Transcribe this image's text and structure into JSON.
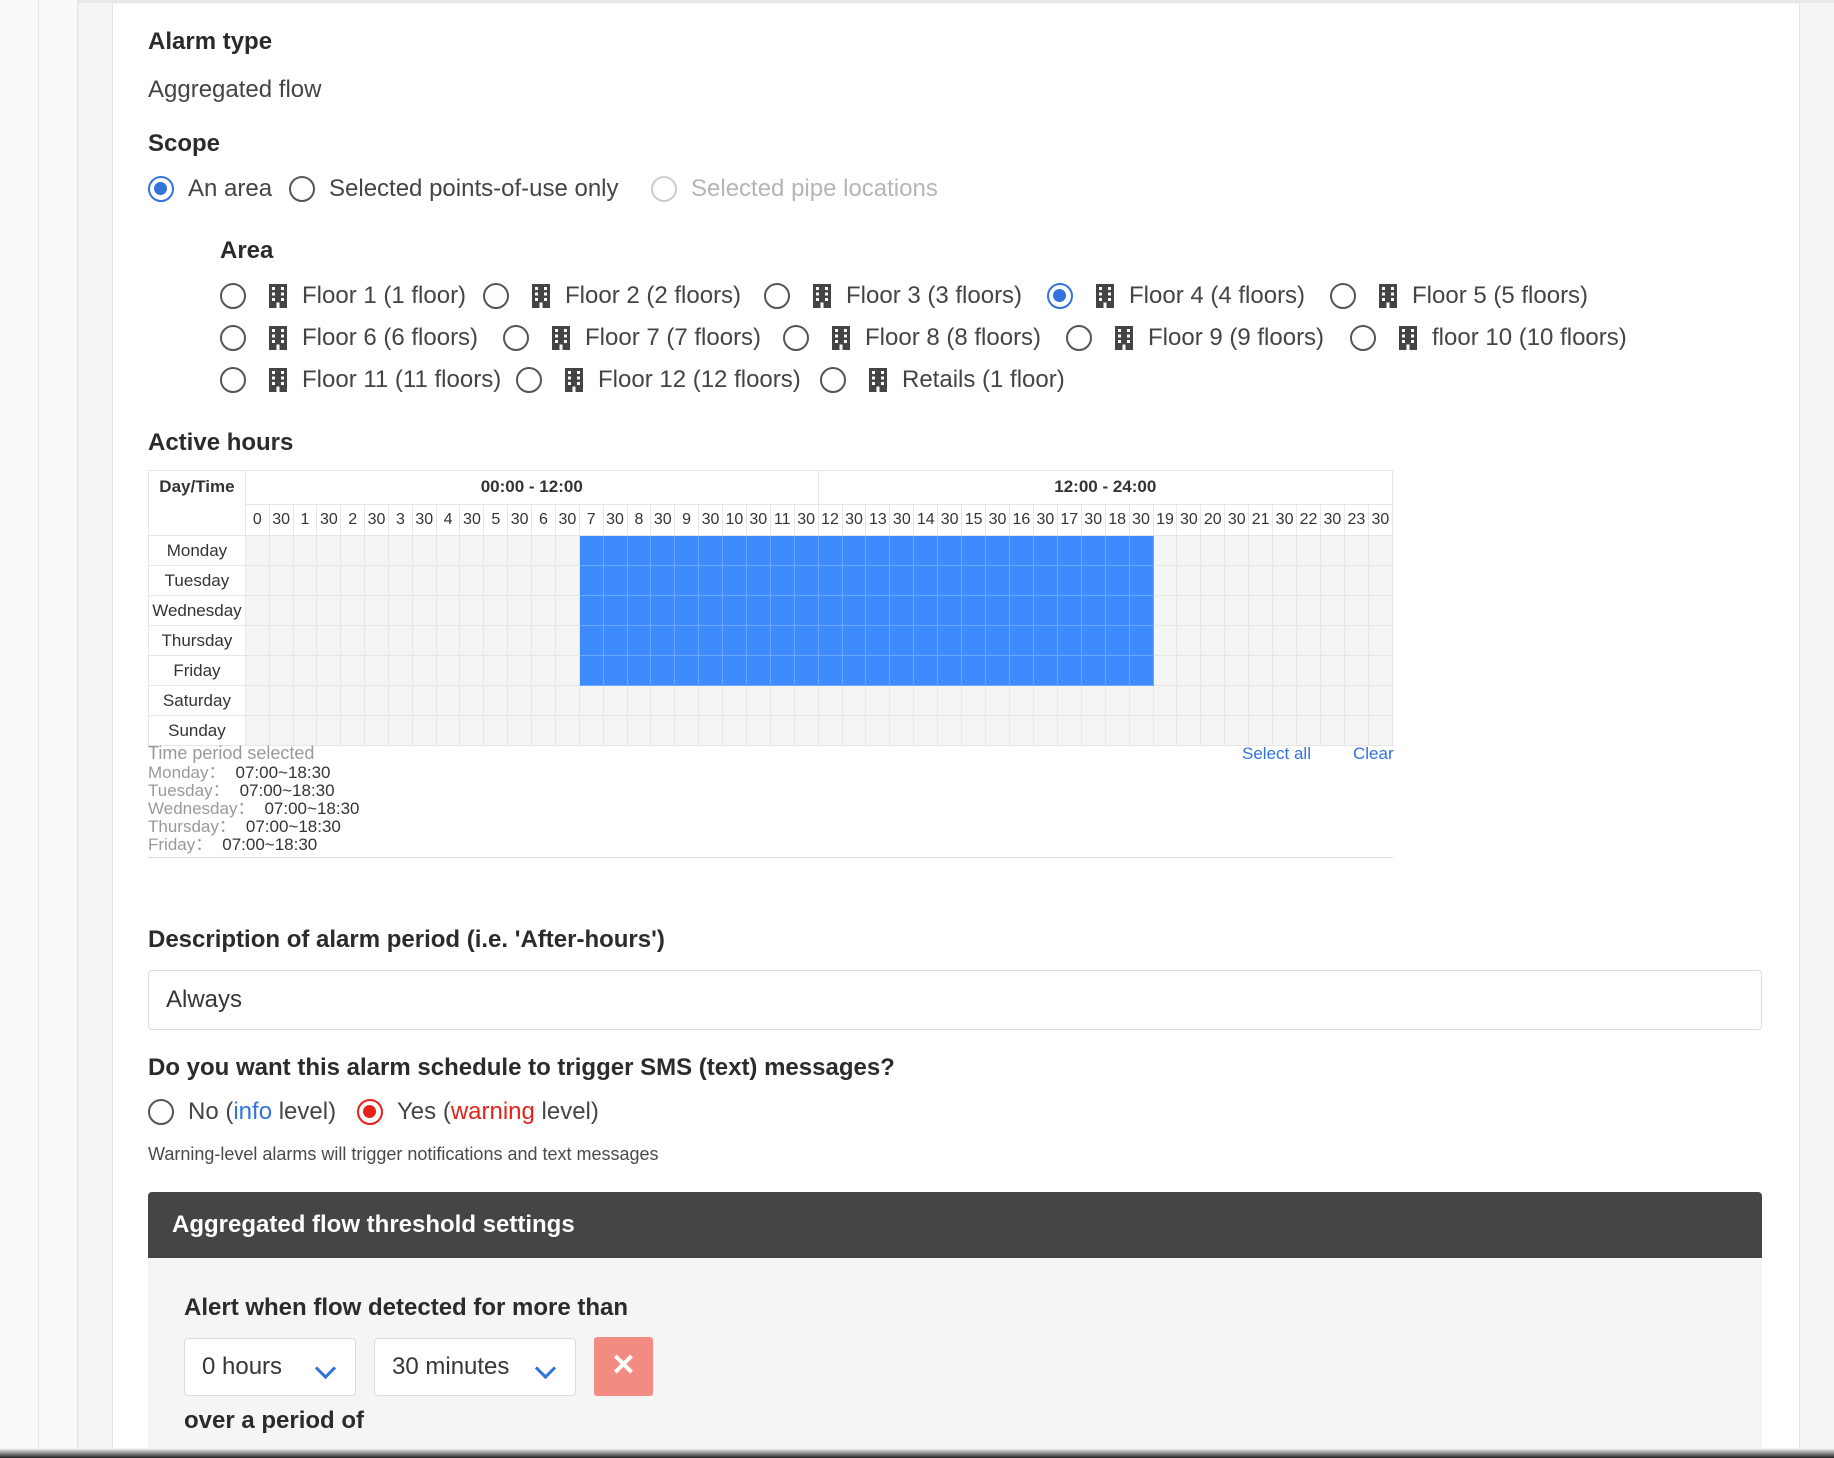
{
  "alarm_type": {
    "label": "Alarm type",
    "value": "Aggregated flow"
  },
  "scope": {
    "label": "Scope",
    "options": [
      {
        "label": "An area",
        "checked": true,
        "disabled": false
      },
      {
        "label": "Selected points-of-use only",
        "checked": false,
        "disabled": false
      },
      {
        "label": "Selected pipe locations",
        "checked": false,
        "disabled": true
      }
    ]
  },
  "area": {
    "label": "Area",
    "options": [
      {
        "label": "Floor 1 (1 floor)",
        "checked": false
      },
      {
        "label": "Floor 2 (2 floors)",
        "checked": false
      },
      {
        "label": "Floor 3 (3 floors)",
        "checked": false
      },
      {
        "label": "Floor 4 (4 floors)",
        "checked": true
      },
      {
        "label": "Floor 5 (5 floors)",
        "checked": false
      },
      {
        "label": "Floor 6 (6 floors)",
        "checked": false
      },
      {
        "label": "Floor 7 (7 floors)",
        "checked": false
      },
      {
        "label": "Floor 8 (8 floors)",
        "checked": false
      },
      {
        "label": "Floor 9 (9 floors)",
        "checked": false
      },
      {
        "label": "floor 10 (10 floors)",
        "checked": false
      },
      {
        "label": "Floor 11 (11 floors)",
        "checked": false
      },
      {
        "label": "Floor 12 (12 floors)",
        "checked": false
      },
      {
        "label": "Retails (1 floor)",
        "checked": false
      }
    ],
    "icon": "building-icon"
  },
  "active_hours": {
    "label": "Active hours",
    "corner_header": "Day/Time",
    "half_headers": [
      "00:00 - 12:00",
      "12:00 - 24:00"
    ],
    "slot_labels": [
      "0",
      "30",
      "1",
      "30",
      "2",
      "30",
      "3",
      "30",
      "4",
      "30",
      "5",
      "30",
      "6",
      "30",
      "7",
      "30",
      "8",
      "30",
      "9",
      "30",
      "10",
      "30",
      "11",
      "30",
      "12",
      "30",
      "13",
      "30",
      "14",
      "30",
      "15",
      "30",
      "16",
      "30",
      "17",
      "30",
      "18",
      "30",
      "19",
      "30",
      "20",
      "30",
      "21",
      "30",
      "22",
      "30",
      "23",
      "30"
    ],
    "days": [
      "Monday",
      "Tuesday",
      "Wednesday",
      "Thursday",
      "Friday",
      "Saturday",
      "Sunday"
    ],
    "selected": [
      {
        "day": "Monday",
        "start": "07:00",
        "end": "18:30"
      },
      {
        "day": "Tuesday",
        "start": "07:00",
        "end": "18:30"
      },
      {
        "day": "Wednesday",
        "start": "07:00",
        "end": "18:30"
      },
      {
        "day": "Thursday",
        "start": "07:00",
        "end": "18:30"
      },
      {
        "day": "Friday",
        "start": "07:00",
        "end": "18:30"
      }
    ],
    "selected_color": "#3d8bfd",
    "summary_title": "Time period selected",
    "summary_rows": [
      {
        "day": "Monday：",
        "range": "07:00~18:30"
      },
      {
        "day": "Tuesday：",
        "range": "07:00~18:30"
      },
      {
        "day": "Wednesday：",
        "range": "07:00~18:30"
      },
      {
        "day": "Thursday：",
        "range": "07:00~18:30"
      },
      {
        "day": "Friday：",
        "range": "07:00~18:30"
      }
    ],
    "select_all": "Select all",
    "clear": "Clear"
  },
  "description": {
    "label": "Description of alarm period (i.e. 'After-hours')",
    "value": "Always"
  },
  "sms": {
    "label": "Do you want this alarm schedule to trigger SMS (text) messages?",
    "no": {
      "prefix": "No (",
      "level": "info",
      "suffix": " level)",
      "checked": false
    },
    "yes": {
      "prefix": "Yes (",
      "level": "warning",
      "suffix": " level)",
      "checked": true
    },
    "hint": "Warning-level alarms will trigger notifications and text messages"
  },
  "threshold": {
    "title": "Aggregated flow threshold settings",
    "alert_label": "Alert when flow detected for more than",
    "hours_value": "0 hours",
    "minutes_value": "30 minutes",
    "remove_symbol": "✕",
    "period_label": "over a period of"
  },
  "colors": {
    "accent": "#3273dc",
    "danger": "#e2231a",
    "header_bg": "#454545"
  }
}
